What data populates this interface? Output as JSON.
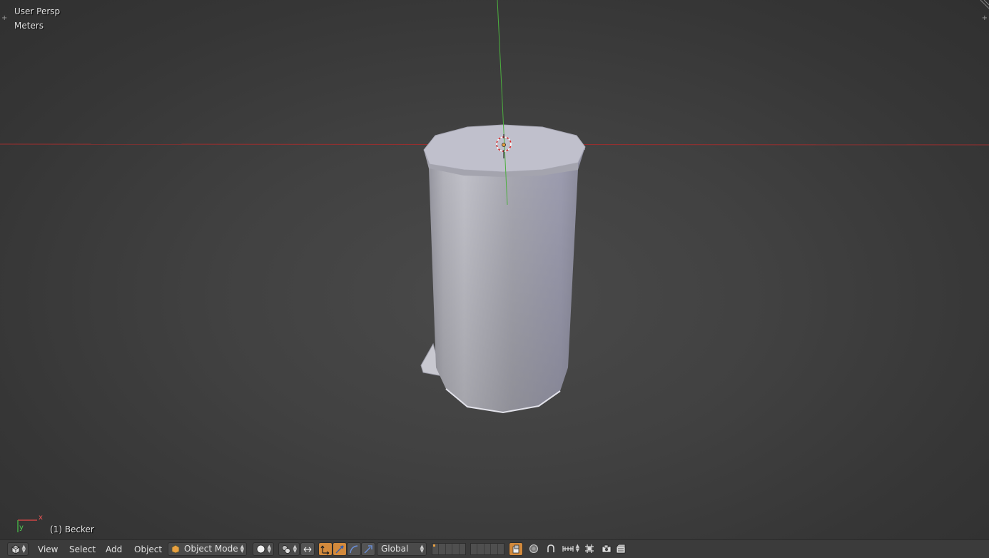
{
  "viewport": {
    "view_label": "User Persp",
    "units_label": "Meters",
    "object_info": "(1) Becker",
    "axis_x": "x",
    "axis_y": "y"
  },
  "header": {
    "menus": {
      "view": "View",
      "select": "Select",
      "add": "Add",
      "object": "Object"
    },
    "mode_label": "Object Mode",
    "orientation_label": "Global"
  },
  "icons": [
    "editor-type-icon",
    "viewport-shading-icon",
    "pivot-point-icon",
    "manipulator-icon",
    "translate-icon",
    "rotate-icon",
    "scale-icon",
    "layer-icon",
    "lock-icon",
    "proportional-edit-icon",
    "snap-icon",
    "snap-target-icon",
    "opengl-render-icon",
    "opengl-anim-icon"
  ],
  "colors": {
    "x_axis": "#9c2e2e",
    "y_axis": "#4caf3f",
    "active_button": "#d38a3c"
  }
}
